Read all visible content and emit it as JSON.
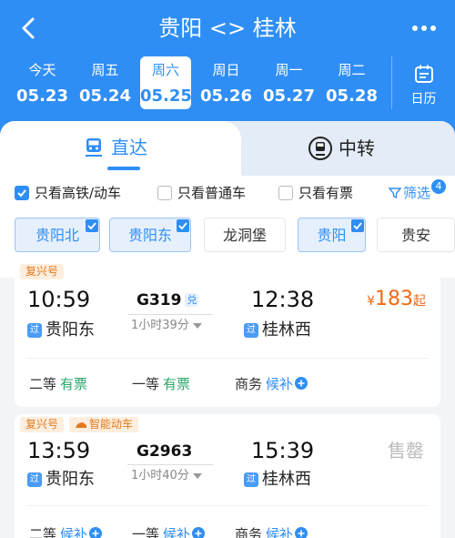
{
  "header": {
    "title": "贵阳 <> 桂林"
  },
  "dates": [
    {
      "weekday": "今天",
      "date": "05.23",
      "active": false
    },
    {
      "weekday": "周五",
      "date": "05.24",
      "active": false
    },
    {
      "weekday": "周六",
      "date": "05.25",
      "active": true
    },
    {
      "weekday": "周日",
      "date": "05.26",
      "active": false
    },
    {
      "weekday": "周一",
      "date": "05.27",
      "active": false
    },
    {
      "weekday": "周二",
      "date": "05.28",
      "active": false
    }
  ],
  "calendar_label": "日历",
  "tabs": {
    "direct": "直达",
    "transfer": "中转"
  },
  "filters": {
    "high_speed_only": "只看高铁/动车",
    "regular_only": "只看普通车",
    "available_only": "只看有票",
    "screen_label": "筛选",
    "screen_count": "4"
  },
  "stations": [
    {
      "name": "贵阳北",
      "selected": true
    },
    {
      "name": "贵阳东",
      "selected": true
    },
    {
      "name": "龙洞堡",
      "selected": false
    },
    {
      "name": "贵阳",
      "selected": true
    },
    {
      "name": "贵安",
      "selected": false
    }
  ],
  "trains": [
    {
      "tags": [
        "复兴号"
      ],
      "depart_time": "10:59",
      "arrive_time": "12:38",
      "train_no": "G319",
      "exchange_badge": "兑",
      "duration": "1小时39分",
      "from_station": "贵阳东",
      "to_station": "桂林西",
      "via_label": "过",
      "price_currency": "¥",
      "price": "183",
      "price_suffix": "起",
      "seats": [
        {
          "class": "二等",
          "status": "有票"
        },
        {
          "class": "一等",
          "status": "有票"
        },
        {
          "class": "商务",
          "status": "候补"
        }
      ]
    },
    {
      "tags": [
        "复兴号",
        "智能动车"
      ],
      "depart_time": "13:59",
      "arrive_time": "15:39",
      "train_no": "G2963",
      "duration": "1小时40分",
      "from_station": "贵阳东",
      "to_station": "桂林西",
      "via_label": "过",
      "status": "售罄",
      "seats": [
        {
          "class": "二等",
          "status": "候补"
        },
        {
          "class": "一等",
          "status": "候补"
        },
        {
          "class": "商务",
          "status": "候补"
        }
      ]
    }
  ],
  "colors": {
    "brand_blue": "#2f8ef5",
    "price_orange": "#f06a14",
    "available_green": "#2aa76b"
  }
}
